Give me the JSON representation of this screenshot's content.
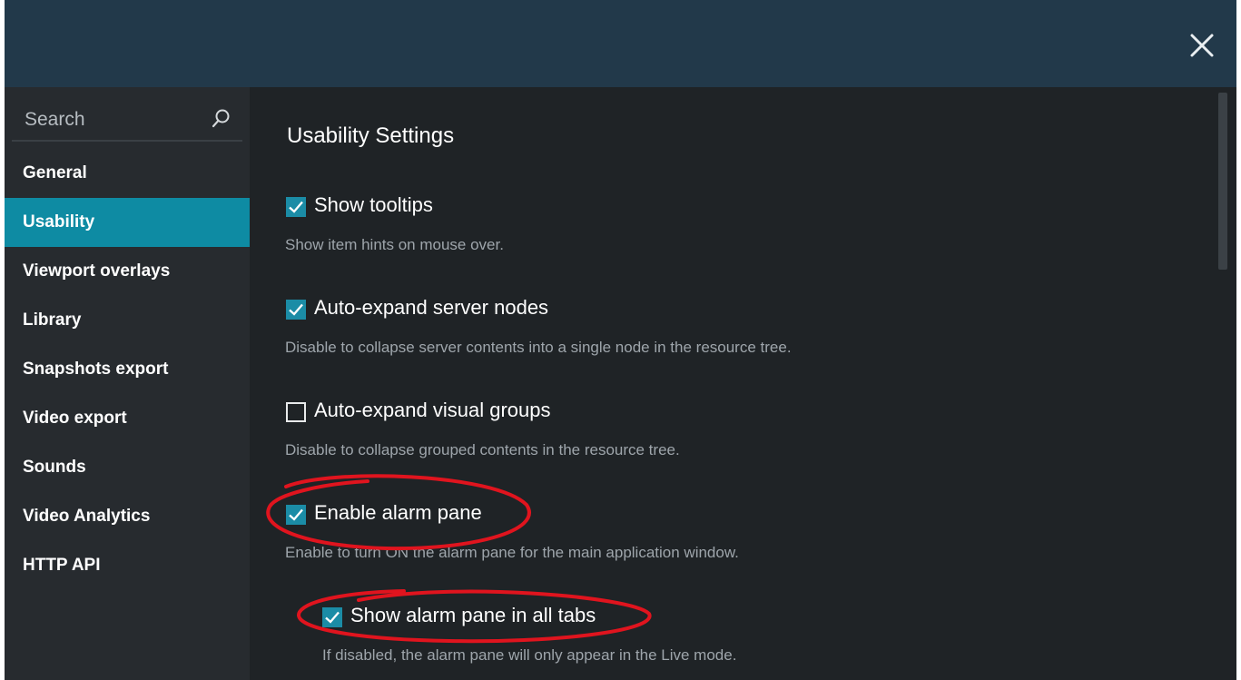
{
  "window": {
    "close_icon": "close-icon"
  },
  "sidebar": {
    "search": {
      "placeholder": "Search",
      "icon": "search-icon"
    },
    "items": [
      {
        "label": "General",
        "active": false
      },
      {
        "label": "Usability",
        "active": true
      },
      {
        "label": "Viewport overlays",
        "active": false
      },
      {
        "label": "Library",
        "active": false
      },
      {
        "label": "Snapshots export",
        "active": false
      },
      {
        "label": "Video export",
        "active": false
      },
      {
        "label": "Sounds",
        "active": false
      },
      {
        "label": "Video Analytics",
        "active": false
      },
      {
        "label": "HTTP API",
        "active": false
      }
    ]
  },
  "main": {
    "title": "Usability Settings",
    "options": [
      {
        "label": "Show tooltips",
        "checked": true,
        "description": "Show item hints on mouse over."
      },
      {
        "label": "Auto-expand server nodes",
        "checked": true,
        "description": "Disable to collapse server contents into a single node in the resource tree."
      },
      {
        "label": "Auto-expand visual groups",
        "checked": false,
        "description": "Disable to collapse grouped contents in the resource tree."
      },
      {
        "label": "Enable alarm pane",
        "checked": true,
        "description": "Enable to turn ON the alarm pane for the main application window."
      },
      {
        "label": "Show alarm pane in all tabs",
        "checked": true,
        "description": "If disabled, the alarm pane will only appear in the Live mode."
      }
    ]
  },
  "colors": {
    "titlebar": "#22394a",
    "accent": "#0e8ba3",
    "annotation": "#e0141e"
  }
}
